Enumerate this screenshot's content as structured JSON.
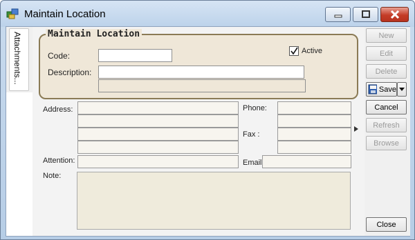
{
  "window": {
    "title": "Maintain Location",
    "icon": "location-app-icon"
  },
  "side_tab": {
    "label": "Attachments..."
  },
  "location_group": {
    "title": "Maintain Location",
    "code_label": "Code:",
    "code_value": "",
    "description_label": "Description:",
    "description_value": "",
    "description2_value": "",
    "active_label": "Active",
    "active_checked": true
  },
  "contact": {
    "address_label": "Address:",
    "address_lines": [
      "",
      "",
      "",
      ""
    ],
    "phone_label": "Phone:",
    "phone_values": [
      "",
      ""
    ],
    "fax_label": "Fax :",
    "fax_values": [
      "",
      ""
    ],
    "attention_label": "Attention:",
    "attention_value": "",
    "email_label": "Email:",
    "email_value": "",
    "note_label": "Note:",
    "note_value": ""
  },
  "buttons": {
    "new": "New",
    "edit": "Edit",
    "delete": "Delete",
    "save": "Save",
    "cancel": "Cancel",
    "refresh": "Refresh",
    "browse": "Browse",
    "close": "Close"
  }
}
